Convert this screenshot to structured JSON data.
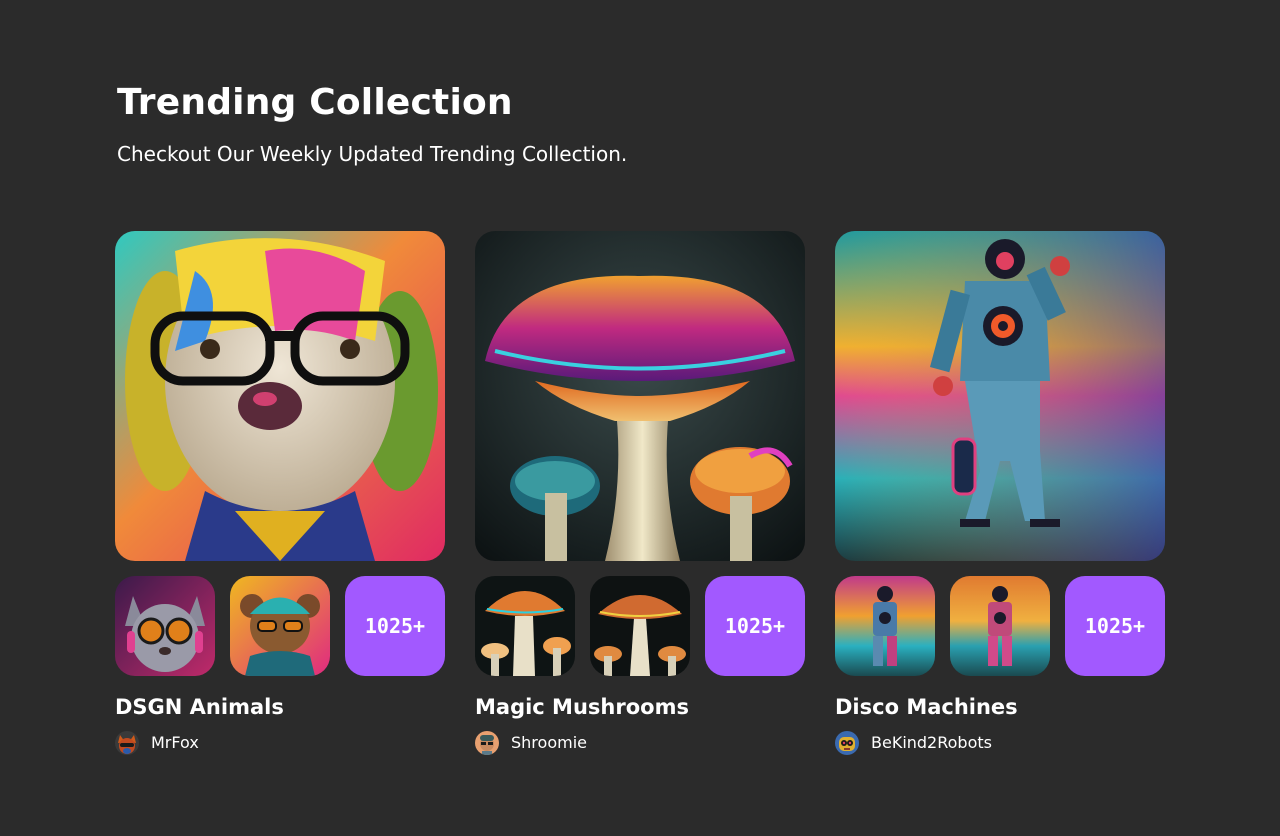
{
  "header": {
    "title": "Trending Collection",
    "subtitle": "Checkout Our Weekly Updated Trending Collection."
  },
  "theme": {
    "background": "#2b2b2b",
    "accent": "#a259ff",
    "text": "#ffffff"
  },
  "collections": [
    {
      "name": "DSGN Animals",
      "count_label": "1025+",
      "artist": "MrFox",
      "hero_image": "colorful-dog-with-glasses",
      "thumb_images": [
        "cat-with-goggles",
        "bear-with-glasses"
      ],
      "avatar_image": "fox-avatar"
    },
    {
      "name": "Magic Mushrooms",
      "count_label": "1025+",
      "artist": "Shroomie",
      "hero_image": "glowing-mushrooms",
      "thumb_images": [
        "mushroom-cluster",
        "mushroom-pair"
      ],
      "avatar_image": "shroomie-avatar"
    },
    {
      "name": "Disco Machines",
      "count_label": "1025+",
      "artist": "BeKind2Robots",
      "hero_image": "disco-robot",
      "thumb_images": [
        "robot-small-1",
        "robot-small-2"
      ],
      "avatar_image": "robot-avatar"
    }
  ]
}
